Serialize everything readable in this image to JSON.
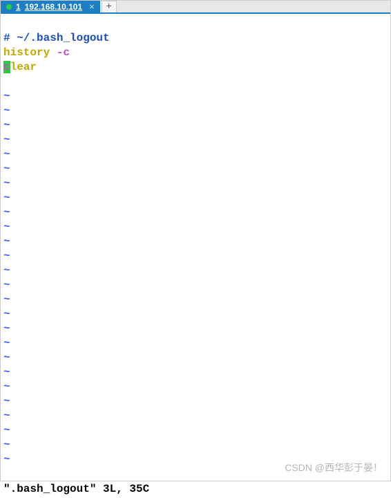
{
  "tab": {
    "index": "1",
    "title": "192.168.10.101",
    "close": "×",
    "new": "+"
  },
  "editor": {
    "line1_hash": "# ",
    "line1_path": "~/.bash_logout",
    "line2_cmd": "history ",
    "line2_arg": "-c",
    "line3_cursor_char": "c",
    "line3_rest": "lear",
    "tilde": "~",
    "tilde_count": 26
  },
  "status": "\".bash_logout\" 3L, 35C",
  "watermark": "CSDN @西华彭于晏！"
}
